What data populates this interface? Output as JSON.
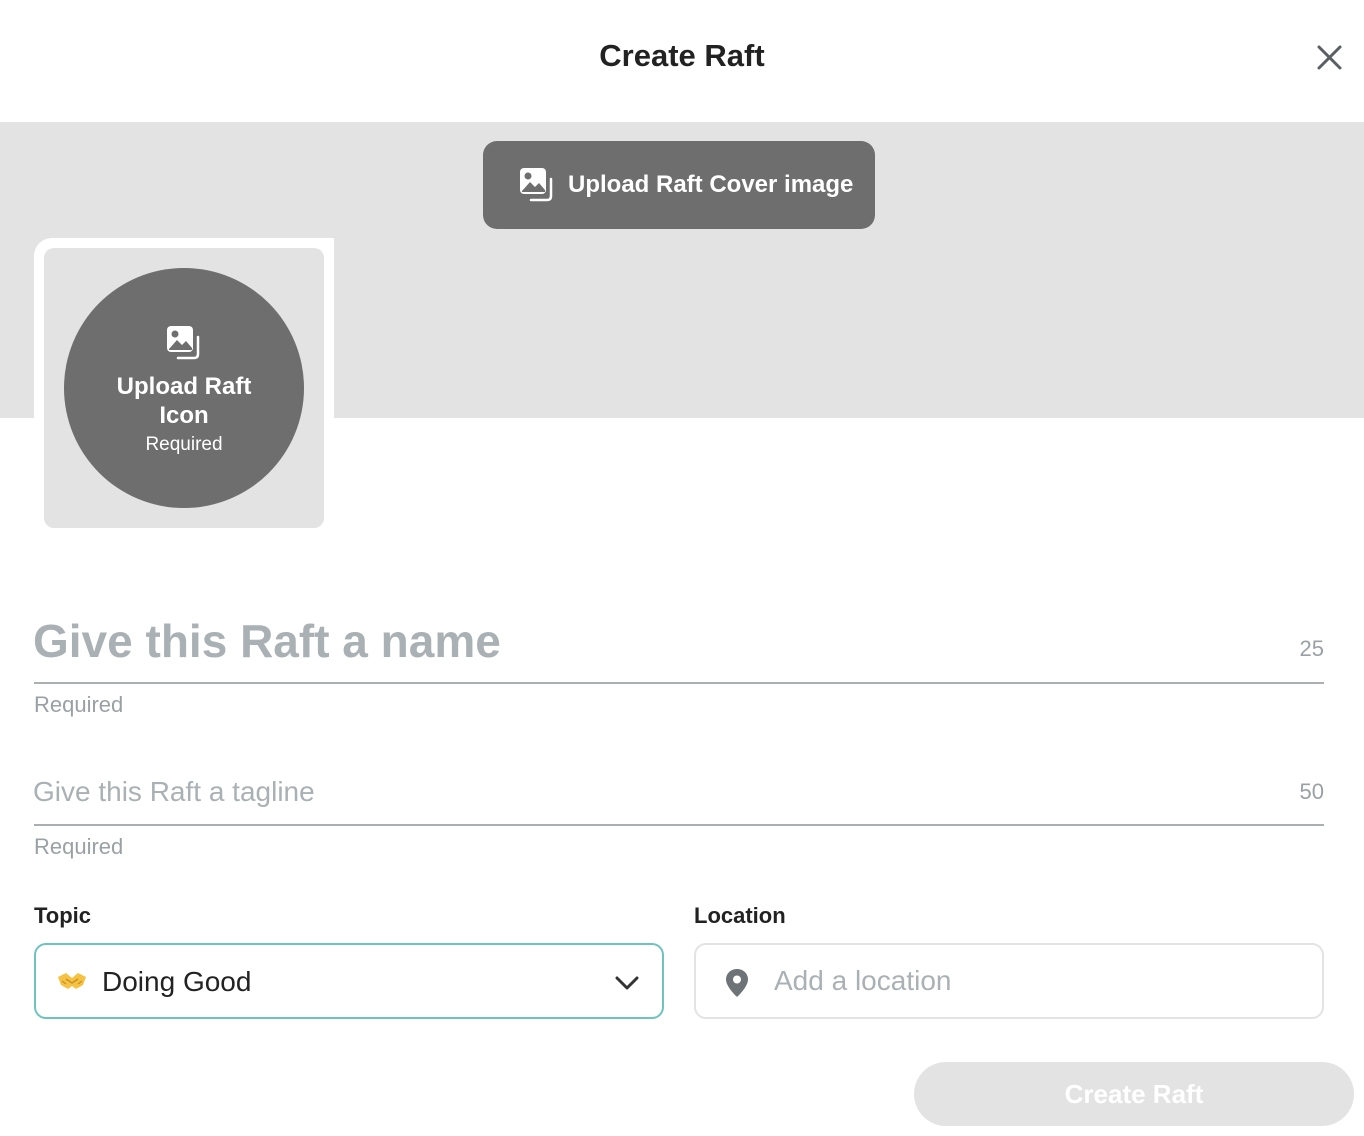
{
  "header": {
    "title": "Create Raft",
    "close_icon": "close-icon"
  },
  "cover": {
    "upload_label": "Upload Raft Cover image",
    "icon": "image-upload-icon"
  },
  "raft_icon": {
    "upload_label": "Upload Raft Icon",
    "required_label": "Required",
    "icon": "image-upload-icon"
  },
  "name_field": {
    "placeholder": "Give this Raft a name",
    "value": "",
    "char_limit": "25",
    "helper": "Required"
  },
  "tagline_field": {
    "placeholder": "Give this Raft a tagline",
    "value": "",
    "char_limit": "50",
    "helper": "Required"
  },
  "topic": {
    "label": "Topic",
    "selected_value": "Doing Good",
    "selected_icon": "handshake-emoji-icon",
    "dropdown_icon": "chevron-down-icon",
    "accent_color": "#6fc3bd"
  },
  "location": {
    "label": "Location",
    "placeholder": "Add a location",
    "value": "",
    "icon": "location-pin-icon"
  },
  "submit": {
    "label": "Create Raft",
    "enabled": false
  },
  "colors": {
    "upload_bg": "#6e6e6e",
    "cover_bg": "#e3e3e3",
    "placeholder_text": "#aab1b5",
    "disabled_button": "#e3e3e3"
  }
}
